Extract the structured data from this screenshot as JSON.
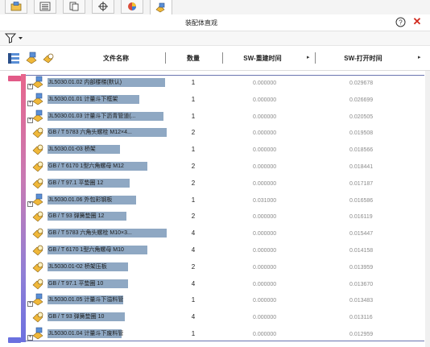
{
  "tabs": [
    {
      "icon": "feature-tree-icon"
    },
    {
      "icon": "property-manager-icon"
    },
    {
      "icon": "configuration-manager-icon"
    },
    {
      "icon": "dimxpert-icon"
    },
    {
      "icon": "display-manager-icon"
    },
    {
      "icon": "assembly-visualization-icon",
      "active": true
    }
  ],
  "panel": {
    "title": "装配体直观",
    "help_icon": "help-icon",
    "close_icon": "close-icon",
    "close_glyph": "✕"
  },
  "toolbar": {
    "filter_icon": "filter-icon"
  },
  "columns": {
    "name": "文件名称",
    "qty": "数量",
    "rebuild": "SW-重建时间",
    "open": "SW-打开时间",
    "arrow": "▸"
  },
  "colors": {
    "bar_top": "#e8658c",
    "bar_bottom": "#6b70e0",
    "highlight": "#8fa8c3",
    "close": "#d12b1f"
  },
  "rows": [
    {
      "name": "JL5030.01.02 内部楼梯(默认)",
      "qty": "1",
      "rebuild": "0.000000",
      "open": "0.029678",
      "icon": "assembly-icon",
      "hl": 146
    },
    {
      "name": "JL5030.01.01 计量斗下框架",
      "qty": "1",
      "rebuild": "0.000000",
      "open": "0.026699",
      "icon": "assembly-icon",
      "hl": 114
    },
    {
      "name": "JL5030.01.03 计量斗下沥青管道(...",
      "qty": "1",
      "rebuild": "0.000000",
      "open": "0.020505",
      "icon": "assembly-icon",
      "hl": 144
    },
    {
      "name": "GB / T 5783 六角头螺栓 M12×4...",
      "qty": "2",
      "rebuild": "0.000000",
      "open": "0.019508",
      "icon": "part-icon",
      "hl": 148
    },
    {
      "name": "JL5030.01-03 桥架",
      "qty": "1",
      "rebuild": "0.000000",
      "open": "0.018566",
      "icon": "part-icon",
      "hl": 90
    },
    {
      "name": "GB / T 6170 1型六角螺母 M12",
      "qty": "2",
      "rebuild": "0.000000",
      "open": "0.018441",
      "icon": "part-icon",
      "hl": 124
    },
    {
      "name": "GB / T 97.1 平垫圈 12",
      "qty": "2",
      "rebuild": "0.000000",
      "open": "0.017187",
      "icon": "part-icon",
      "hl": 102
    },
    {
      "name": "JL5030.01.06 外包彩钢板",
      "qty": "1",
      "rebuild": "0.031000",
      "open": "0.016586",
      "icon": "assembly-icon",
      "hl": 110
    },
    {
      "name": "GB / T 93 弹簧垫圈 12",
      "qty": "2",
      "rebuild": "0.000000",
      "open": "0.016119",
      "icon": "part-icon",
      "hl": 98
    },
    {
      "name": "GB / T 5783 六角头螺栓 M10×3...",
      "qty": "4",
      "rebuild": "0.000000",
      "open": "0.015447",
      "icon": "part-icon",
      "hl": 148
    },
    {
      "name": "GB / T 6170 1型六角螺母 M10",
      "qty": "4",
      "rebuild": "0.000000",
      "open": "0.014158",
      "icon": "part-icon",
      "hl": 124
    },
    {
      "name": "JL5030.01-02 桥架压板",
      "qty": "2",
      "rebuild": "0.000000",
      "open": "0.013959",
      "icon": "part-icon",
      "hl": 100
    },
    {
      "name": "GB / T 97.1 平垫圈 10",
      "qty": "4",
      "rebuild": "0.000000",
      "open": "0.013670",
      "icon": "part-icon",
      "hl": 100
    },
    {
      "name": "JL5030.01.05 计量斗下溢料管",
      "qty": "1",
      "rebuild": "0.000000",
      "open": "0.013483",
      "icon": "assembly-icon",
      "hl": 94
    },
    {
      "name": "GB / T 93 弹簧垫圈 10",
      "qty": "4",
      "rebuild": "0.000000",
      "open": "0.013116",
      "icon": "part-icon",
      "hl": 96
    },
    {
      "name": "JL5030.01.04 计量斗下废料管",
      "qty": "1",
      "rebuild": "0.000000",
      "open": "0.012959",
      "icon": "assembly-icon",
      "hl": 92
    }
  ]
}
